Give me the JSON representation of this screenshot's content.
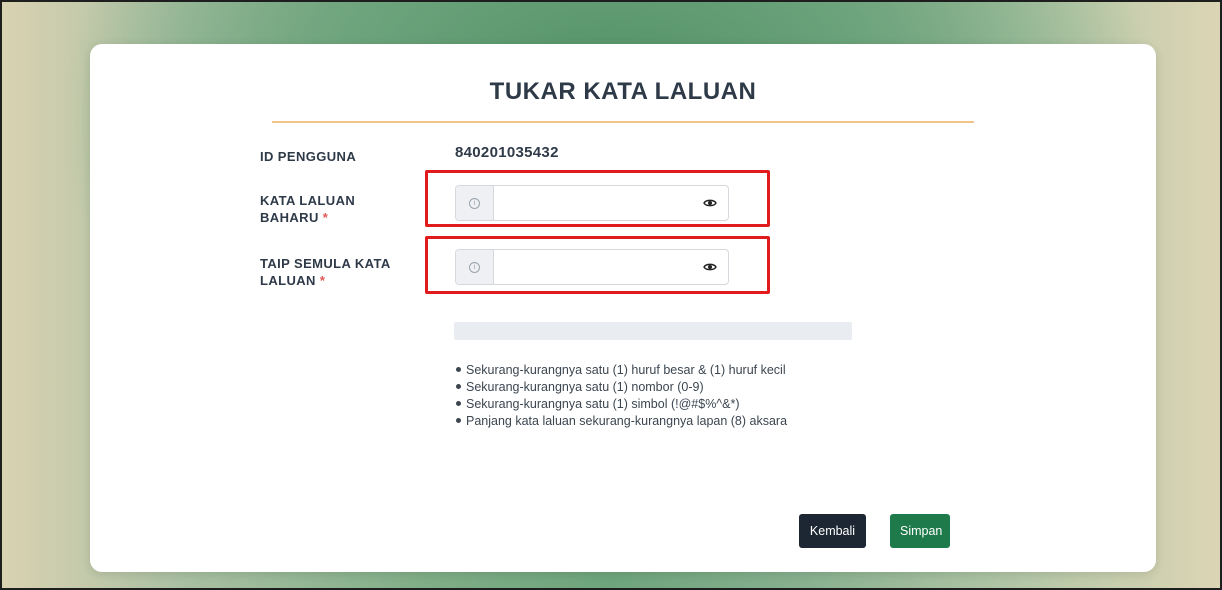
{
  "page": {
    "title": "TUKAR KATA LALUAN"
  },
  "form": {
    "user_id": {
      "label": "ID PENGGUNA",
      "value": "840201035432"
    },
    "new_password": {
      "label_line1": "KATA LALUAN",
      "label_line2": "BAHARU",
      "required_mark": "*",
      "value": "",
      "info_icon": "info-circle-icon",
      "toggle_icon": "eye-icon"
    },
    "confirm_password": {
      "label_line1": "TAIP SEMULA KATA",
      "label_line2": "LALUAN",
      "required_mark": "*",
      "value": "",
      "info_icon": "info-circle-icon",
      "toggle_icon": "eye-icon"
    }
  },
  "password_rules": [
    "Sekurang-kurangnya satu (1) huruf besar & (1) huruf kecil",
    "Sekurang-kurangnya satu (1) nombor (0-9)",
    "Sekurang-kurangnya satu (1) simbol (!@#$%^&*)",
    "Panjang kata laluan sekurang-kurangnya lapan (8) aksara"
  ],
  "buttons": {
    "back_label": "Kembali",
    "save_label": "Simpan"
  },
  "colors": {
    "highlight": "#e11b1b",
    "back_button": "#1c2733",
    "save_button": "#1e7a4a",
    "title_rule": "#f2c48a",
    "required": "#e05757"
  }
}
